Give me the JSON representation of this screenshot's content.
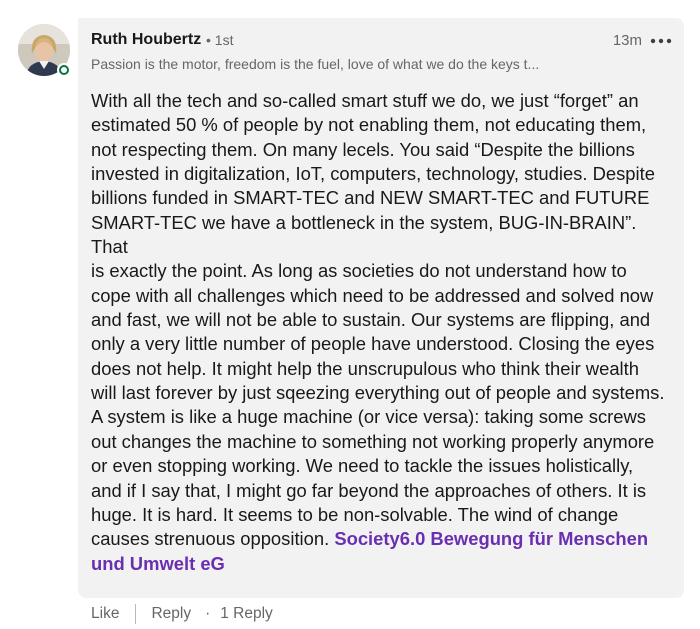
{
  "comment": {
    "author": {
      "name": "Ruth Houbertz",
      "degree": "• 1st",
      "headline": "Passion is the motor, freedom is the fuel, love of what we do the keys t...",
      "online": true
    },
    "timestamp": "13m",
    "more_icon": "ellipsis-icon",
    "text_lines": [
      "With all the tech and so-called smart stuff we do, we just “forget” an",
      "estimated 50 % of people by not enabling them, not educating them,",
      "not respecting them. On many lecels. You said “Despite the billions",
      "invested in digitalization, IoT, computers, technology, studies. Despite",
      "billions funded in SMART-TEC and NEW SMART-TEC and FUTURE",
      "SMART-TEC we have a bottleneck in the system, BUG-IN-BRAIN”. That",
      "is exactly the point. As long as societies do not understand how to",
      "cope with all challenges which need to be addressed and solved now",
      "and fast, we will not be able to sustain. Our systems are flipping, and",
      "only a very little number of people have understood. Closing the eyes",
      "does not help. It might help the unscrupulous who think their wealth",
      "will last forever by just sqeezing everything out of people and systems.",
      "A system is like a huge machine (or vice versa): taking some screws",
      "out changes the machine to something not working properly anymore",
      "or even stopping working. We need to tackle the issues holistically,",
      "and if I say that, I might go far beyond the approaches of others. It is",
      "huge. It is hard. It seems to be non-solvable. The wind of change",
      "causes strenuous opposition. "
    ],
    "mention_line1": "Society6.0 Bewegung für Menschen",
    "mention_line2": "und Umwelt eG"
  },
  "actions": {
    "like": "Like",
    "reply": "Reply",
    "separator": "·",
    "replies": "1 Reply"
  },
  "colors": {
    "bubble_bg": "#f2f2f2",
    "mention": "#6a2fb1",
    "online": "#057642",
    "secondary_text": "#666666"
  }
}
